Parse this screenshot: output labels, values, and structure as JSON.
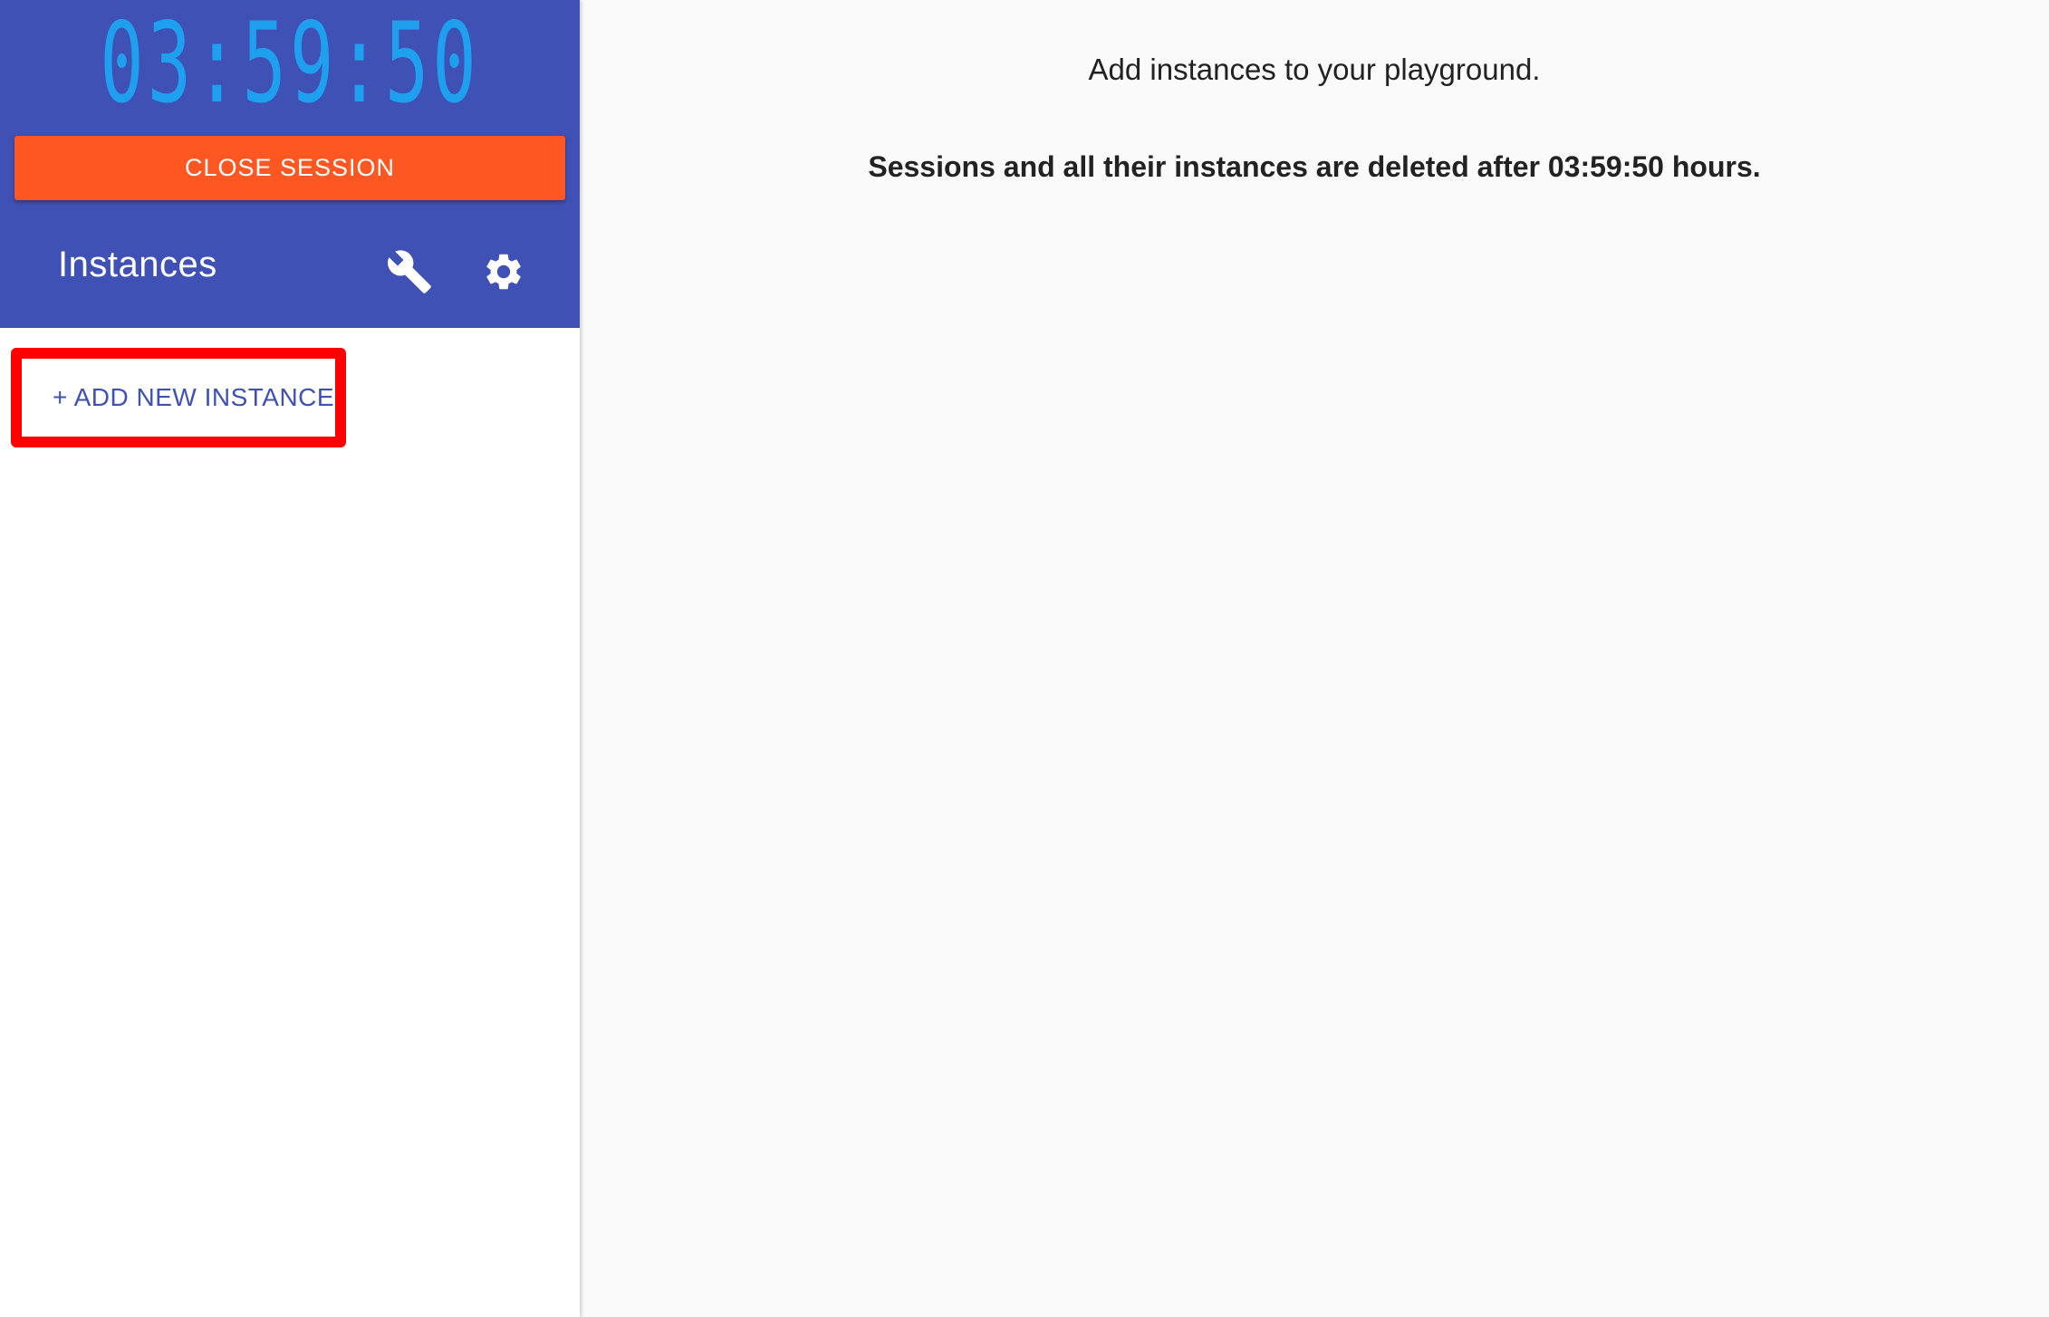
{
  "sidebar": {
    "timer": "03:59:50",
    "close_session_label": "CLOSE SESSION",
    "instances_title": "Instances",
    "add_instance_label": "+ ADD NEW INSTANCE",
    "icons": {
      "wrench": "wrench-icon",
      "settings": "gear-icon"
    }
  },
  "main": {
    "intro": "Add instances to your playground.",
    "warning": "Sessions and all their instances are deleted after 03:59:50 hours."
  },
  "colors": {
    "header_bg": "#3f51b5",
    "timer": "#1ea0ee",
    "close_button": "#ff5722",
    "highlight_box": "#ff0000",
    "add_instance_text": "#3f51b5"
  }
}
